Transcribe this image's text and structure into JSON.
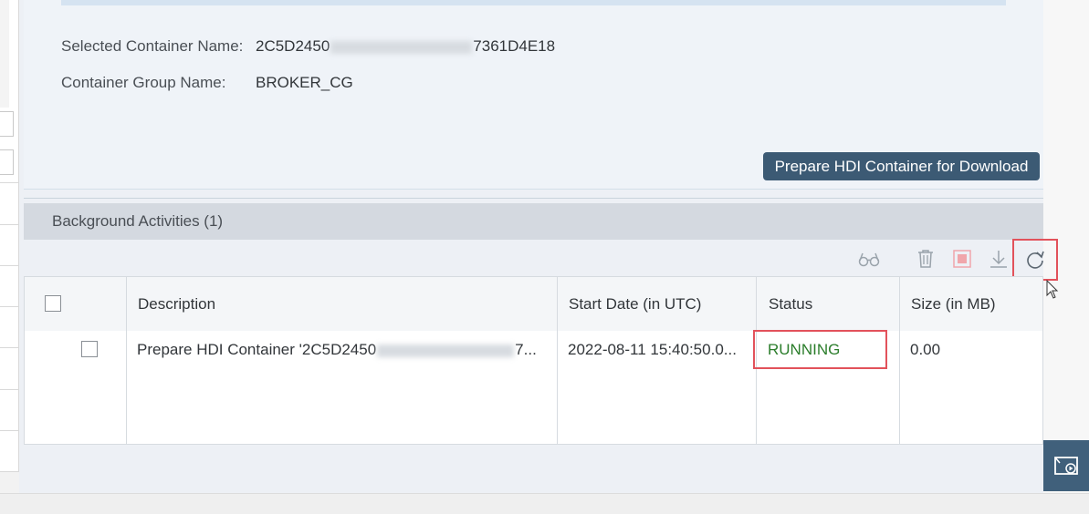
{
  "info": {
    "container_label": "Selected Container Name:",
    "container_value_start": "2C5D2450",
    "container_value_end": "7361D4E18",
    "group_label": "Container Group Name:",
    "group_value": "BROKER_CG",
    "prepare_button": "Prepare HDI Container for Download"
  },
  "activities": {
    "title": "Background Activities (1)",
    "toolbar_icons": [
      "glasses-icon",
      "trash-icon",
      "stop-icon",
      "download-icon",
      "refresh-icon"
    ],
    "columns": [
      "Description",
      "Start Date (in UTC)",
      "Status",
      "Size (in MB)"
    ],
    "rows": [
      {
        "description_start": "Prepare HDI Container '2C5D2450",
        "description_end": "7...",
        "start_date": "2022-08-11 15:40:50.0...",
        "status": "RUNNING",
        "size": "0.00"
      }
    ]
  },
  "colors": {
    "primary_button": "#3c5a74",
    "highlight": "#e2525b",
    "running": "#2b7d2b"
  }
}
